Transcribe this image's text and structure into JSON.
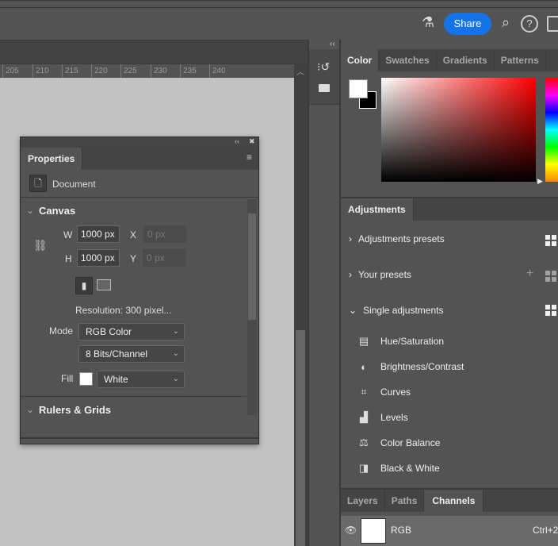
{
  "topbar": {
    "share_label": "Share",
    "icons": [
      "beaker-icon",
      "search-icon",
      "help-icon",
      "workspace-icon"
    ]
  },
  "ruler": {
    "ticks": [
      "205",
      "210",
      "215",
      "220",
      "225",
      "230",
      "235",
      "240"
    ]
  },
  "right_column": {
    "collapse": "‹‹"
  },
  "color_panel": {
    "tabs": [
      "Color",
      "Swatches",
      "Gradients",
      "Patterns"
    ],
    "active": "Color",
    "foreground": "#ffffff",
    "background": "#000000",
    "hue": "#ff0000"
  },
  "properties": {
    "title": "Properties",
    "doc_label": "Document",
    "canvas_section": "Canvas",
    "w_label": "W",
    "w_value": "1000 px",
    "h_label": "H",
    "h_value": "1000 px",
    "x_label": "X",
    "x_value": "0 px",
    "y_label": "Y",
    "y_value": "0 px",
    "resolution": "Resolution: 300 pixel...",
    "mode_label": "Mode",
    "mode_value": "RGB Color",
    "bits_value": "8 Bits/Channel",
    "fill_label": "Fill",
    "fill_value": "White",
    "fill_color": "#ffffff",
    "rulers_section": "Rulers & Grids"
  },
  "adjustments": {
    "tab": "Adjustments",
    "presets": "Adjustments presets",
    "your_presets": "Your presets",
    "single": "Single adjustments",
    "items": [
      "Hue/Saturation",
      "Brightness/Contrast",
      "Curves",
      "Levels",
      "Color Balance",
      "Black & White"
    ]
  },
  "bottom_panel": {
    "tabs": [
      "Layers",
      "Paths",
      "Channels"
    ],
    "active": "Channels",
    "channel_name": "RGB",
    "channel_shortcut": "Ctrl+2"
  }
}
